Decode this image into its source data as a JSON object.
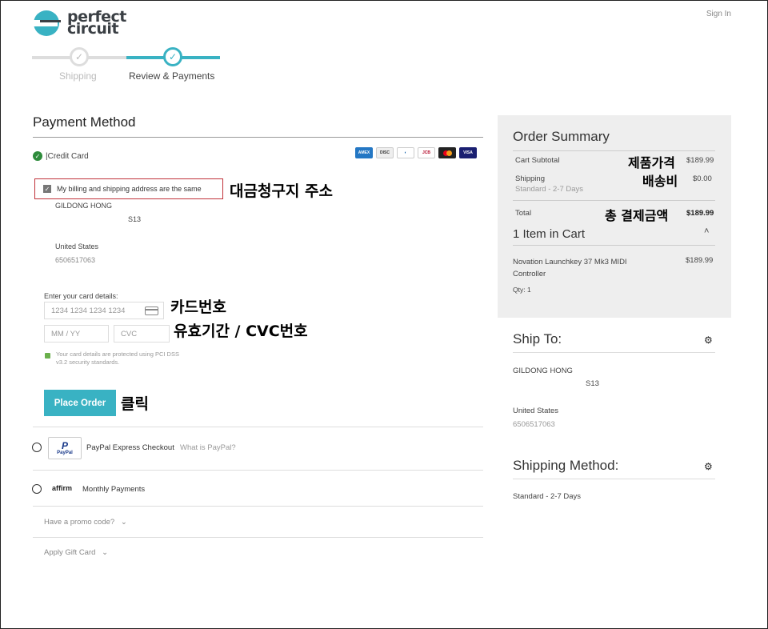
{
  "header": {
    "logo_line1": "perfect",
    "logo_line2": "circuit",
    "sign_in": "Sign In"
  },
  "progress": {
    "steps": [
      {
        "label": "Shipping",
        "state": "done"
      },
      {
        "label": "Review & Payments",
        "state": "active"
      }
    ],
    "check_glyph": "✓"
  },
  "payment": {
    "title": "Payment Method",
    "credit_card_label": "|Credit Card",
    "card_brands": [
      "AMEX",
      "DISCOVER",
      "Diners",
      "JCB",
      "Mastercard",
      "VISA"
    ],
    "billing_same_label": "My billing and shipping address are the same",
    "billing_address": {
      "name": "GILDONG HONG",
      "line2": "S13",
      "country": "United States",
      "phone": "6506517063"
    },
    "card_details_label": "Enter your card details:",
    "card_number_placeholder": "1234 1234 1234 1234",
    "expiry_placeholder": "MM / YY",
    "cvc_placeholder": "CVC",
    "secure_note": "Your card details are protected using PCI DSS v3.2 security standards.",
    "place_order": "Place Order",
    "paypal_label": "PayPal Express Checkout",
    "paypal_help": "What is PayPal?",
    "paypal_logo": "PayPal",
    "affirm_logo": "affirm",
    "affirm_label": "Monthly Payments",
    "promo": "Have a promo code?",
    "gift": "Apply Gift Card"
  },
  "annotations": {
    "billing": "대금청구지 주소",
    "card_number": "카드번호",
    "expiry_cvc": "유효기간 / CVC번호",
    "click": "클릭",
    "subtotal": "제품가격",
    "shipping": "배송비",
    "total": "총 결제금액"
  },
  "summary": {
    "title": "Order Summary",
    "subtotal_label": "Cart Subtotal",
    "subtotal_value": "$189.99",
    "shipping_label": "Shipping",
    "shipping_sub": "Standard - 2-7 Days",
    "shipping_value": "$0.00",
    "total_label": "Total",
    "total_value": "$189.99",
    "items_title": "1 Item in Cart",
    "item_name_line1": "Novation Launchkey 37 Mk3 MIDI",
    "item_name_line2": "Controller",
    "item_price": "$189.99",
    "item_qty": "Qty: 1"
  },
  "ship_to": {
    "title": "Ship To:",
    "name": "GILDONG HONG",
    "line2": "S13",
    "country": "United States",
    "phone": "6506517063"
  },
  "shipping_method": {
    "title": "Shipping Method:",
    "value": "Standard - 2-7 Days"
  },
  "colors": {
    "accent": "#39b2c3",
    "annotation_box": "#c0323a",
    "check_green": "#2e8b3b",
    "summary_bg": "#eeeeee"
  },
  "icons": [
    "check-icon",
    "card-icon",
    "lock-icon",
    "chevron-down-icon",
    "chevron-up-icon",
    "gear-icon"
  ]
}
